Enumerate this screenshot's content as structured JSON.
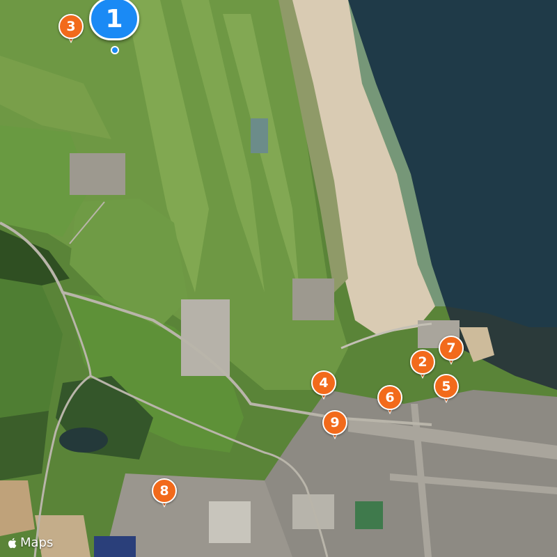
{
  "map": {
    "type": "satellite",
    "attribution": "Maps",
    "attribution_icon": "apple-logo-icon",
    "selected_pin": {
      "label": "1",
      "color": "#1a8af5"
    },
    "pins": [
      {
        "label": "2",
        "color": "#f26a1b"
      },
      {
        "label": "3",
        "color": "#f26a1b"
      },
      {
        "label": "4",
        "color": "#f26a1b"
      },
      {
        "label": "5",
        "color": "#f26a1b"
      },
      {
        "label": "6",
        "color": "#f26a1b"
      },
      {
        "label": "7",
        "color": "#f26a1b"
      },
      {
        "label": "8",
        "color": "#f26a1b"
      },
      {
        "label": "9",
        "color": "#f26a1b"
      }
    ],
    "colors": {
      "sea": "#1f3a48",
      "beach": "#d9cbb3",
      "grass": "#5f8f3c",
      "fairway": "#7ea24c",
      "town": "#8d8a83"
    }
  }
}
